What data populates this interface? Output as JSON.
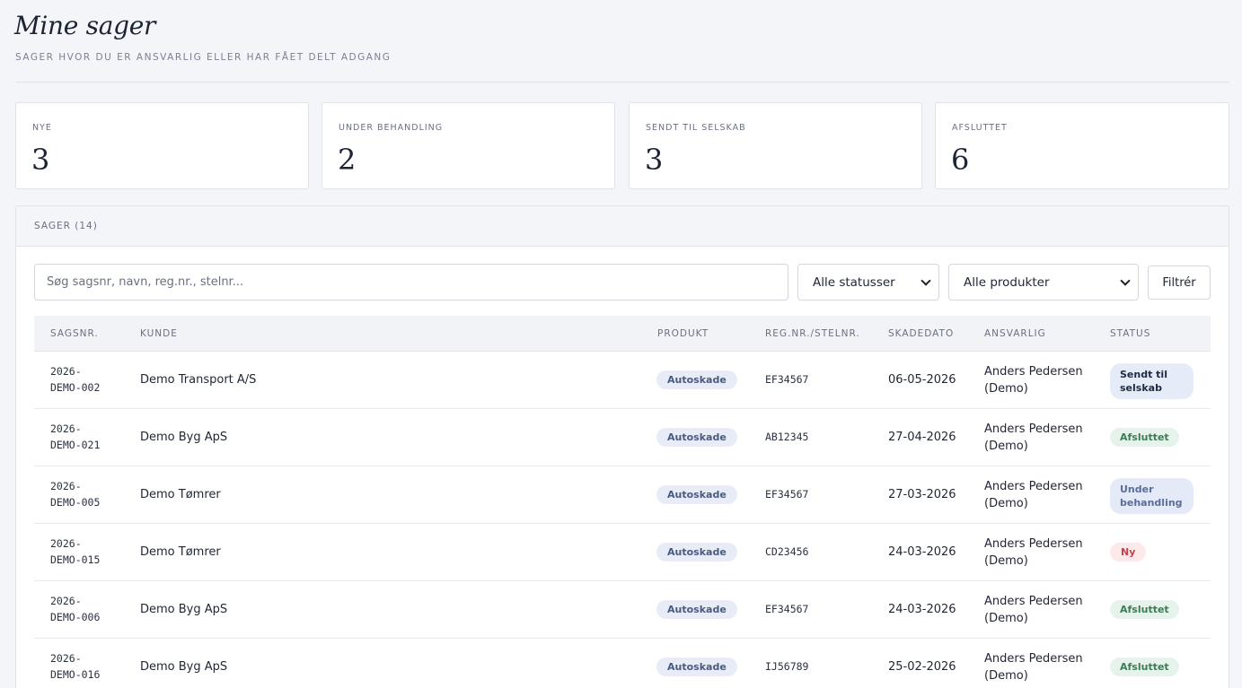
{
  "header": {
    "title": "Mine sager",
    "subtitle": "SAGER HVOR DU ER ANSVARLIG ELLER HAR FÅET DELT ADGANG"
  },
  "stats": [
    {
      "label": "NYE",
      "value": "3"
    },
    {
      "label": "UNDER BEHANDLING",
      "value": "2"
    },
    {
      "label": "SENDT TIL SELSKAB",
      "value": "3"
    },
    {
      "label": "AFSLUTTET",
      "value": "6"
    }
  ],
  "panel": {
    "title": "SAGER (14)"
  },
  "filters": {
    "search_placeholder": "Søg sagsnr, navn, reg.nr., stelnr...",
    "status_selected": "Alle statusser",
    "product_selected": "Alle produkter",
    "filter_button": "Filtrér"
  },
  "table": {
    "headers": {
      "case_no": "SAGSNR.",
      "customer": "KUNDE",
      "product": "PRODUKT",
      "reg": "REG.NR./STELNR.",
      "damage_date": "SKADEDATO",
      "responsible": "ANSVARLIG",
      "status": "STATUS"
    },
    "rows": [
      {
        "case_no": "2026-\nDEMO-002",
        "customer": "Demo Transport A/S",
        "product": "Autoskade",
        "reg": "EF34567",
        "damage_date": "06-05-2026",
        "responsible": "Anders Pedersen\n(Demo)",
        "status": "Sendt til selskab",
        "status_kind": "sendt"
      },
      {
        "case_no": "2026-\nDEMO-021",
        "customer": "Demo Byg ApS",
        "product": "Autoskade",
        "reg": "AB12345",
        "damage_date": "27-04-2026",
        "responsible": "Anders Pedersen\n(Demo)",
        "status": "Afsluttet",
        "status_kind": "af"
      },
      {
        "case_no": "2026-\nDEMO-005",
        "customer": "Demo Tømrer",
        "product": "Autoskade",
        "reg": "EF34567",
        "damage_date": "27-03-2026",
        "responsible": "Anders Pedersen\n(Demo)",
        "status": "Under behandling",
        "status_kind": "under"
      },
      {
        "case_no": "2026-\nDEMO-015",
        "customer": "Demo Tømrer",
        "product": "Autoskade",
        "reg": "CD23456",
        "damage_date": "24-03-2026",
        "responsible": "Anders Pedersen\n(Demo)",
        "status": "Ny",
        "status_kind": "ny"
      },
      {
        "case_no": "2026-\nDEMO-006",
        "customer": "Demo Byg ApS",
        "product": "Autoskade",
        "reg": "EF34567",
        "damage_date": "24-03-2026",
        "responsible": "Anders Pedersen\n(Demo)",
        "status": "Afsluttet",
        "status_kind": "af"
      },
      {
        "case_no": "2026-\nDEMO-016",
        "customer": "Demo Byg ApS",
        "product": "Autoskade",
        "reg": "IJ56789",
        "damage_date": "25-02-2026",
        "responsible": "Anders Pedersen\n(Demo)",
        "status": "Afsluttet",
        "status_kind": "af"
      }
    ]
  }
}
